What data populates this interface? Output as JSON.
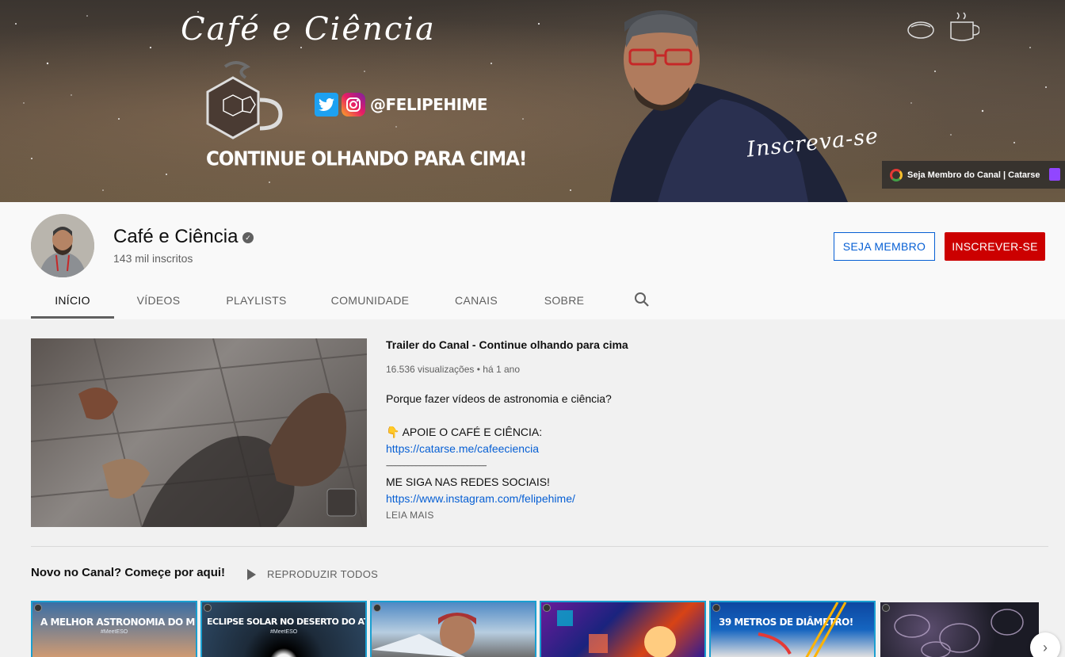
{
  "banner": {
    "title": "Café e Ciência",
    "handle": "@FELIPEHIME",
    "tagline": "CONTINUE OLHANDO PARA CIMA!",
    "cta": "Inscreva-se",
    "link_label": "Seja Membro do Canal | Catarse"
  },
  "channel": {
    "name": "Café e Ciência",
    "subscribers": "143 mil inscritos",
    "member_label": "SEJA MEMBRO",
    "subscribe_label": "INSCREVER-SE"
  },
  "tabs": [
    {
      "label": "INÍCIO",
      "active": true
    },
    {
      "label": "VÍDEOS"
    },
    {
      "label": "PLAYLISTS"
    },
    {
      "label": "COMUNIDADE"
    },
    {
      "label": "CANAIS"
    },
    {
      "label": "SOBRE"
    }
  ],
  "trailer": {
    "title": "Trailer do Canal - Continue olhando para cima",
    "views": "16.536 visualizações",
    "dot": "•",
    "age": "há 1 ano",
    "desc_line1": "Porque fazer vídeos de astronomia e ciência?",
    "support_icon": "👇",
    "support_line": "APOIE O CAFÉ E CIÊNCIA:",
    "catarse_link": "https://catarse.me/cafeeciencia",
    "separator": "----------------------------------------------------------------------------",
    "follow_line": "ME SIGA NAS REDES SOCIAIS!",
    "instagram_link": "https://www.instagram.com/felipehime/",
    "read_more": "LEIA MAIS"
  },
  "shelf": {
    "title": "Novo no Canal? Começe por aqui!",
    "play_all": "REPRODUZIR TODOS",
    "thumbs": [
      {
        "text": "A MELHOR ASTRONOMIA DO MUNDO!",
        "sub": "#MeetESO"
      },
      {
        "text": "ECLIPSE SOLAR NO DESERTO DO ATACAMA",
        "sub": "#MeetESO"
      },
      {
        "text": "",
        "sub": ""
      },
      {
        "text": "",
        "sub": ""
      },
      {
        "text": "39 METROS DE DIÂMETRO!",
        "sub": ""
      },
      {
        "text": "",
        "sub": ""
      }
    ]
  },
  "icons": {
    "verified": "check-circle-icon",
    "search": "search-icon",
    "next": "chevron-right-icon"
  },
  "colors": {
    "subscribe": "#cc0000",
    "link": "#065fd4",
    "thumb_border": "#1a9fd0"
  }
}
